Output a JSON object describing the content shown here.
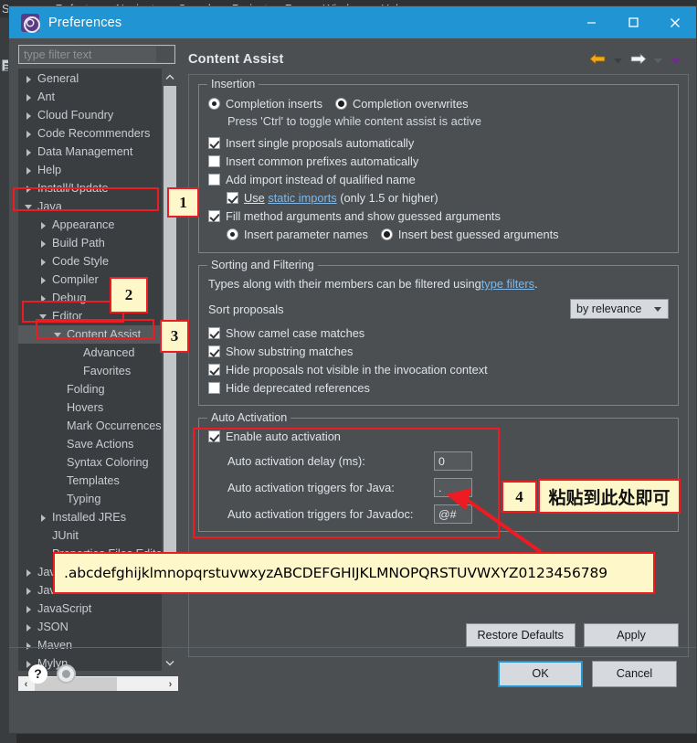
{
  "ide_menubar": [
    "Source",
    "Refactor",
    "Navigate",
    "Search",
    "Project",
    "Run",
    "Window",
    "Help"
  ],
  "window": {
    "title": "Preferences",
    "minimize_label": "–",
    "maximize_label": "□",
    "close_label": "✕"
  },
  "filter": {
    "placeholder": "type filter text",
    "value": ""
  },
  "tree": [
    {
      "label": "General",
      "indent": 0,
      "state": "closed",
      "selected": false
    },
    {
      "label": "Ant",
      "indent": 0,
      "state": "closed",
      "selected": false
    },
    {
      "label": "Cloud Foundry",
      "indent": 0,
      "state": "closed",
      "selected": false
    },
    {
      "label": "Code Recommenders",
      "indent": 0,
      "state": "closed",
      "selected": false
    },
    {
      "label": "Data Management",
      "indent": 0,
      "state": "closed",
      "selected": false
    },
    {
      "label": "Help",
      "indent": 0,
      "state": "closed",
      "selected": false
    },
    {
      "label": "Install/Update",
      "indent": 0,
      "state": "closed",
      "selected": false
    },
    {
      "label": "Java",
      "indent": 0,
      "state": "open",
      "selected": false
    },
    {
      "label": "Appearance",
      "indent": 1,
      "state": "closed",
      "selected": false
    },
    {
      "label": "Build Path",
      "indent": 1,
      "state": "closed",
      "selected": false
    },
    {
      "label": "Code Style",
      "indent": 1,
      "state": "closed",
      "selected": false
    },
    {
      "label": "Compiler",
      "indent": 1,
      "state": "closed",
      "selected": false
    },
    {
      "label": "Debug",
      "indent": 1,
      "state": "closed",
      "selected": false
    },
    {
      "label": "Editor",
      "indent": 1,
      "state": "open",
      "selected": false
    },
    {
      "label": "Content Assist",
      "indent": 2,
      "state": "open",
      "selected": true
    },
    {
      "label": "Advanced",
      "indent": 3,
      "state": "none",
      "selected": false
    },
    {
      "label": "Favorites",
      "indent": 3,
      "state": "none",
      "selected": false
    },
    {
      "label": "Folding",
      "indent": 2,
      "state": "none",
      "selected": false
    },
    {
      "label": "Hovers",
      "indent": 2,
      "state": "none",
      "selected": false
    },
    {
      "label": "Mark Occurrences",
      "indent": 2,
      "state": "none",
      "selected": false
    },
    {
      "label": "Save Actions",
      "indent": 2,
      "state": "none",
      "selected": false
    },
    {
      "label": "Syntax Coloring",
      "indent": 2,
      "state": "none",
      "selected": false
    },
    {
      "label": "Templates",
      "indent": 2,
      "state": "none",
      "selected": false
    },
    {
      "label": "Typing",
      "indent": 2,
      "state": "none",
      "selected": false
    },
    {
      "label": "Installed JREs",
      "indent": 1,
      "state": "closed",
      "selected": false
    },
    {
      "label": "JUnit",
      "indent": 1,
      "state": "none",
      "selected": false
    },
    {
      "label": "Properties Files Editor",
      "indent": 1,
      "state": "none",
      "selected": false
    },
    {
      "label": "Java EE",
      "indent": 0,
      "state": "closed",
      "selected": false
    },
    {
      "label": "Java Persistence",
      "indent": 0,
      "state": "closed",
      "selected": false
    },
    {
      "label": "JavaScript",
      "indent": 0,
      "state": "closed",
      "selected": false
    },
    {
      "label": "JSON",
      "indent": 0,
      "state": "closed",
      "selected": false
    },
    {
      "label": "Maven",
      "indent": 0,
      "state": "closed",
      "selected": false
    },
    {
      "label": "Mylyn",
      "indent": 0,
      "state": "closed",
      "selected": false
    }
  ],
  "page": {
    "title": "Content Assist",
    "nav": {
      "back_icon": "back-arrow-icon",
      "back_menu_icon": "chevron-down-icon",
      "forward_icon": "forward-arrow-icon",
      "forward_menu_icon": "chevron-down-icon",
      "view_menu_icon": "chevron-down-icon"
    }
  },
  "insertion": {
    "legend": "Insertion",
    "completion_inserts": {
      "label": "Completion inserts",
      "checked": true
    },
    "completion_overwrites": {
      "label": "Completion overwrites",
      "checked": false
    },
    "ctrl_hint": "Press 'Ctrl' to toggle while content assist is active",
    "insert_single": {
      "label": "Insert single proposals automatically",
      "checked": true
    },
    "insert_common": {
      "label": "Insert common prefixes automatically",
      "checked": false
    },
    "add_import": {
      "label": "Add import instead of qualified name",
      "checked": false
    },
    "use_static": {
      "prefix": "Use",
      "link": "static imports",
      "suffix": "(only 1.5 or higher)",
      "checked": true
    },
    "fill_method": {
      "label": "Fill method arguments and show guessed arguments",
      "checked": true
    },
    "insert_param_names": {
      "label": "Insert parameter names",
      "checked": true
    },
    "insert_best_guessed": {
      "label": "Insert best guessed arguments",
      "checked": false
    }
  },
  "sorting": {
    "legend": "Sorting and Filtering",
    "types_text_prefix": "Types along with their members can be filtered using ",
    "types_link": "type filters",
    "types_text_suffix": ".",
    "sort_proposals_label": "Sort proposals",
    "sort_proposals_value": "by relevance",
    "camel_case": {
      "label": "Show camel case matches",
      "checked": true
    },
    "substring": {
      "label": "Show substring matches",
      "checked": true
    },
    "hide_not_visible": {
      "label": "Hide proposals not visible in the invocation context",
      "checked": true
    },
    "hide_deprecated": {
      "label": "Hide deprecated references",
      "checked": false
    }
  },
  "auto_activation": {
    "legend": "Auto Activation",
    "enable": {
      "label": "Enable auto activation",
      "checked": true
    },
    "delay_label": "Auto activation delay (ms):",
    "delay_value": "0",
    "java_triggers_label": "Auto activation triggers for Java:",
    "java_triggers_value": ".",
    "javadoc_triggers_label": "Auto activation triggers for Javadoc:",
    "javadoc_triggers_value": "@#"
  },
  "card_buttons": {
    "restore_defaults": "Restore Defaults",
    "apply": "Apply"
  },
  "footer": {
    "help_icon": "question-mark-icon",
    "ring_icon": "settings-ring-icon",
    "ok": "OK",
    "cancel": "Cancel"
  },
  "annotations": {
    "callout_1": "1",
    "callout_2": "2",
    "callout_3": "3",
    "callout_4": "4",
    "note_cjk": "粘贴到此处即可",
    "alphabet_note": ".abcdefghijklmnopqrstuvwxyzABCDEFGHIJKLMNOPQRSTUVWXYZ0123456789",
    "accent_red": "#ee1c22",
    "note_bg": "#fdf7c9"
  },
  "colors": {
    "titlebar": "#2195d3",
    "dialog_bg": "#4b4f52",
    "tree_bg": "#3b3e41",
    "link": "#7fb8e8"
  }
}
